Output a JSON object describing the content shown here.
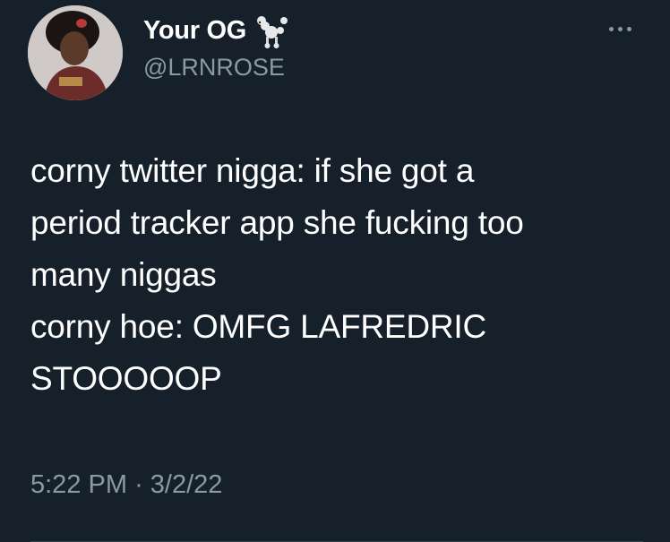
{
  "author": {
    "display_name": "Your OG",
    "handle": "@LRNROSE",
    "emoji_icon": "poodle-icon"
  },
  "tweet": {
    "text": "corny twitter nigga: if she got a\nperiod tracker app she fucking too\nmany niggas\ncorny hoe: OMFG LAFREDRIC\nSTOOOOOP",
    "time": "5:22 PM",
    "separator": "·",
    "date": "3/2/22"
  },
  "colors": {
    "background": "#15202b",
    "secondary_text": "#8b98a5",
    "primary_text": "#ffffff"
  }
}
